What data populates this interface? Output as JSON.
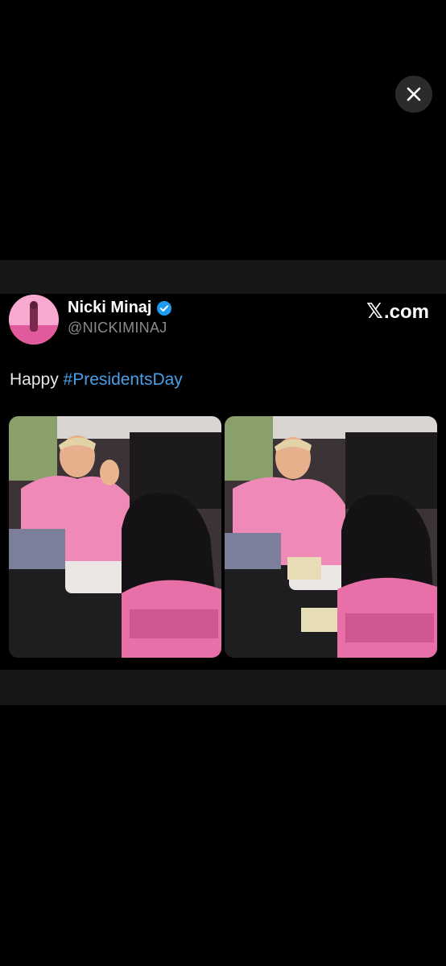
{
  "viewer": {
    "close_icon": "close-icon"
  },
  "tweet": {
    "author": {
      "display_name": "Nicki Minaj",
      "handle": "@NICKIMINAJ",
      "verified_icon": "verified-badge-icon"
    },
    "source": {
      "logo_icon": "x-logo-icon",
      "logo_text": ".com"
    },
    "text": {
      "prefix": "Happy ",
      "hashtag": "#PresidentsDay"
    },
    "media": [
      {
        "name": "photo-1"
      },
      {
        "name": "photo-2"
      }
    ]
  },
  "colors": {
    "background": "#000000",
    "band": "#161616",
    "hashtag": "#4a9fe6",
    "handle": "#8b8b8b",
    "verified": "#1d9bf0"
  }
}
